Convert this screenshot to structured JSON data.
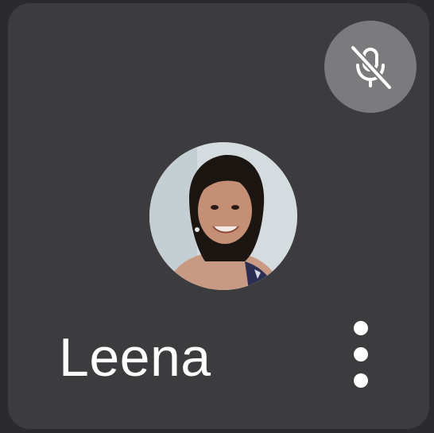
{
  "participant": {
    "name": "Leena",
    "muted": true,
    "icons": {
      "mute": "mic-off-icon",
      "menu": "more-vert-icon"
    }
  },
  "colors": {
    "tile_bg": "#3c3c3f",
    "badge_bg": "#7b7b7e",
    "text": "#ffffff"
  }
}
